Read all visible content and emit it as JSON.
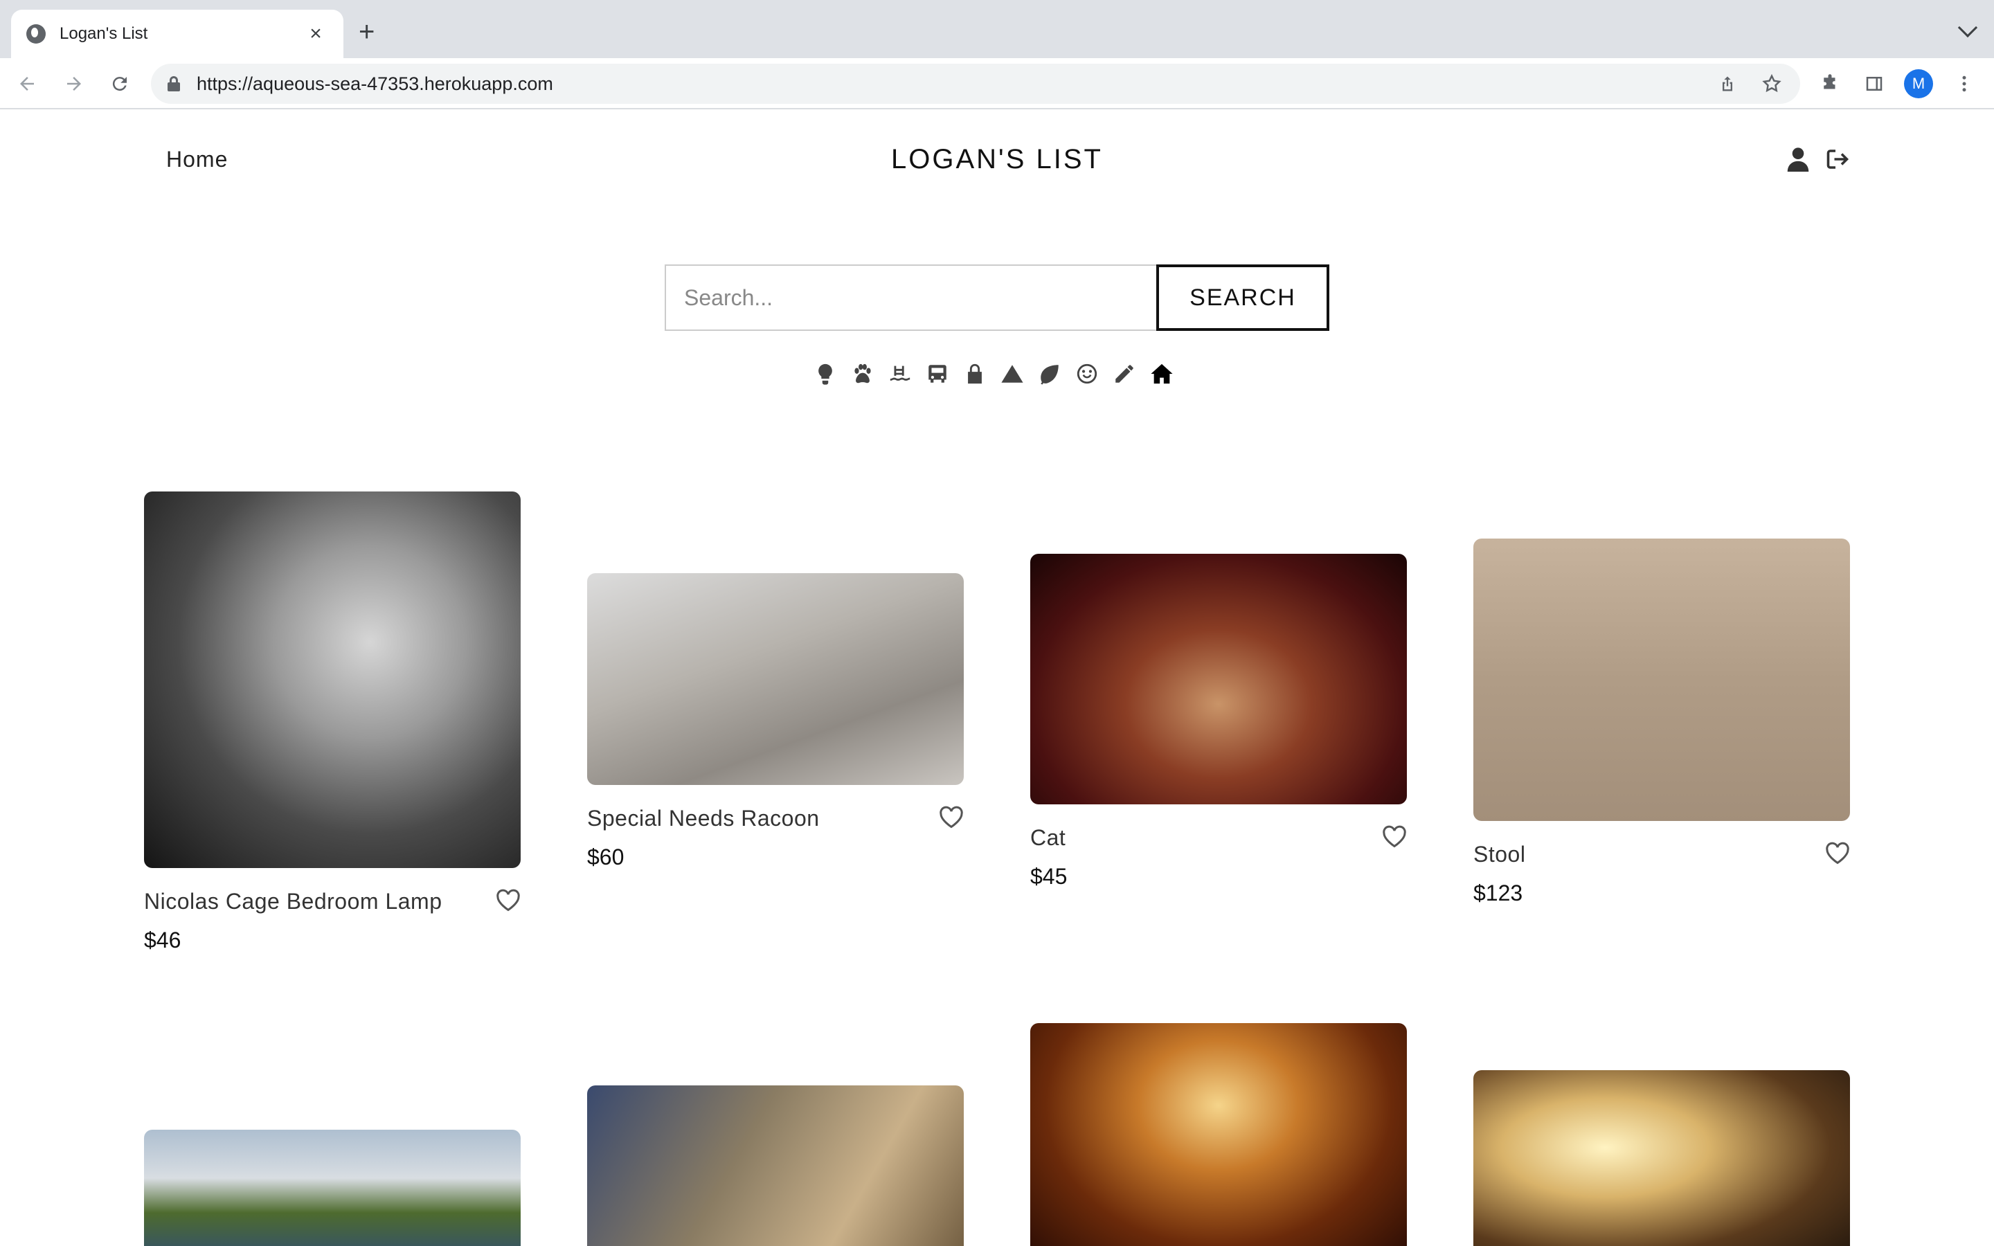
{
  "browser": {
    "tab_title": "Logan's List",
    "url": "https://aqueous-sea-47353.herokuapp.com",
    "profile_initial": "M"
  },
  "nav": {
    "home_label": "Home",
    "site_title": "LOGAN'S LIST"
  },
  "search": {
    "placeholder": "Search...",
    "button_label": "SEARCH"
  },
  "categories": [
    {
      "icon": "lightbulb-icon"
    },
    {
      "icon": "paw-icon"
    },
    {
      "icon": "swimmer-icon"
    },
    {
      "icon": "bus-icon"
    },
    {
      "icon": "lock-icon"
    },
    {
      "icon": "mountain-icon"
    },
    {
      "icon": "leaf-icon"
    },
    {
      "icon": "smile-icon"
    },
    {
      "icon": "pencil-icon"
    },
    {
      "icon": "home-icon",
      "active": true
    }
  ],
  "products": [
    {
      "name": "Nicolas Cage Bedroom Lamp",
      "price": "$46"
    },
    {
      "name": "Special Needs Racoon",
      "price": "$60"
    },
    {
      "name": "Cat",
      "price": "$45"
    },
    {
      "name": "Stool",
      "price": "$123"
    },
    {
      "name": "",
      "price": ""
    },
    {
      "name": "",
      "price": ""
    },
    {
      "name": "",
      "price": ""
    },
    {
      "name": "",
      "price": ""
    }
  ]
}
